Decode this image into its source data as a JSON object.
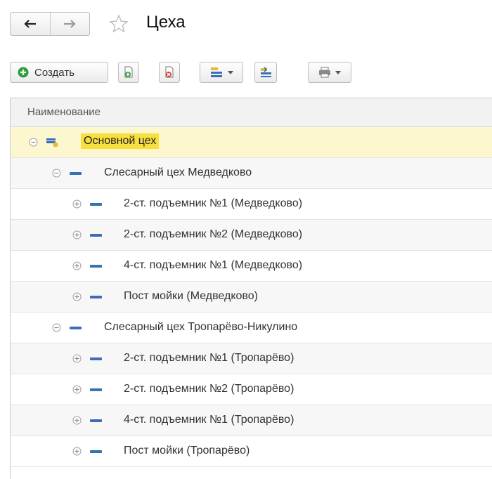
{
  "window": {
    "title": "Цеха"
  },
  "toolbar": {
    "create_label": "Создать",
    "buttons": [
      "add-copy-icon",
      "mark-delete-icon",
      "folder-tree-icon",
      "move-to-group-icon",
      "print-icon"
    ]
  },
  "table": {
    "column_header": "Наименование",
    "rows": [
      {
        "label": "Основной цех",
        "level": 0,
        "state": "expanded",
        "selected": true
      },
      {
        "label": "Слесарный цех Медведково",
        "level": 1,
        "state": "expanded"
      },
      {
        "label": "2-ст. подъемник №1 (Медведково)",
        "level": 2,
        "state": "collapsed"
      },
      {
        "label": "2-ст. подъемник №2 (Медведково)",
        "level": 2,
        "state": "collapsed"
      },
      {
        "label": "4-ст. подъемник №1 (Медведково)",
        "level": 2,
        "state": "collapsed"
      },
      {
        "label": "Пост мойки (Медведково)",
        "level": 2,
        "state": "collapsed"
      },
      {
        "label": "Слесарный цех Тропарёво-Никулино",
        "level": 1,
        "state": "expanded"
      },
      {
        "label": "2-ст. подъемник №1 (Тропарёво)",
        "level": 2,
        "state": "collapsed"
      },
      {
        "label": "2-ст. подъемник №2 (Тропарёво)",
        "level": 2,
        "state": "collapsed"
      },
      {
        "label": "4-ст. подъемник №1 (Тропарёво)",
        "level": 2,
        "state": "collapsed"
      },
      {
        "label": "Пост мойки (Тропарёво)",
        "level": 2,
        "state": "collapsed"
      }
    ]
  },
  "colors": {
    "selected_row": "#fdf7cf",
    "selected_text_bg": "#f8df3d",
    "item_icon": "#3a6fb8",
    "create_icon": "#2e9e3a"
  }
}
